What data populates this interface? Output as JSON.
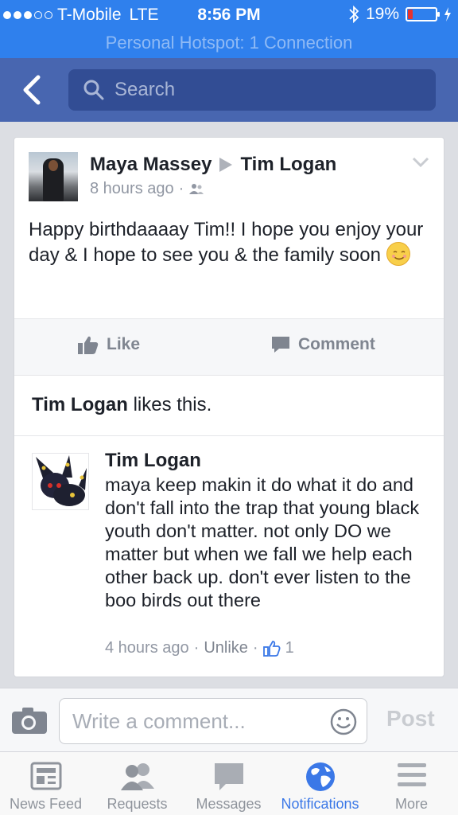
{
  "status_bar": {
    "carrier": "T-Mobile",
    "network": "LTE",
    "time": "8:56 PM",
    "battery": "19%",
    "battery_level": 0.19,
    "signal_bars_filled": 3
  },
  "hotspot": {
    "text": "Personal Hotspot: 1 Connection"
  },
  "search": {
    "placeholder": "Search"
  },
  "post": {
    "author": "Maya Massey",
    "target": "Tim Logan",
    "time": "8 hours ago",
    "text": "Happy birthdaaaay Tim!! I hope you enjoy your day & I hope to see you & the family soon"
  },
  "actions": {
    "like": "Like",
    "comment": "Comment"
  },
  "likes": {
    "name": "Tim Logan",
    "suffix": "likes this."
  },
  "comment": {
    "author": "Tim Logan",
    "text": "maya keep makin it do what it do and don't fall into the trap that young black youth don't matter. not only DO we matter but when we fall we help each other back up. don't ever listen to the boo birds out there",
    "time": "4 hours ago",
    "unlike": "Unlike",
    "like_count": "1"
  },
  "composer": {
    "placeholder": "Write a comment...",
    "post": "Post"
  },
  "tabs": [
    {
      "label": "News Feed",
      "icon": "news-feed-icon"
    },
    {
      "label": "Requests",
      "icon": "requests-icon"
    },
    {
      "label": "Messages",
      "icon": "messages-icon"
    },
    {
      "label": "Notifications",
      "icon": "globe-icon"
    },
    {
      "label": "More",
      "icon": "menu-icon"
    }
  ],
  "colors": {
    "status_bar": "#2f80ed",
    "nav_bar": "#4866b0",
    "active_tab": "#3b78e7"
  }
}
